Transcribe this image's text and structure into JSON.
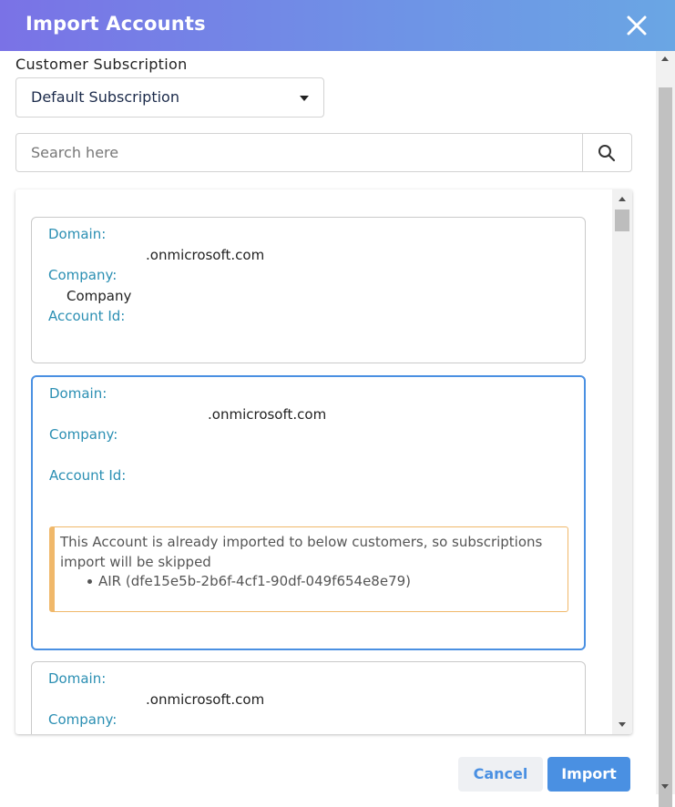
{
  "header": {
    "title": "Import Accounts"
  },
  "subscription": {
    "label": "Customer Subscription",
    "selected": "Default Subscription"
  },
  "search": {
    "placeholder": "Search here"
  },
  "accounts": [
    {
      "domain_label": "Domain:",
      "domain_value": ".onmicrosoft.com",
      "company_label": "Company:",
      "company_value": "Company",
      "account_label": "Account Id:",
      "account_value": ""
    },
    {
      "domain_label": "Domain:",
      "domain_value": ".onmicrosoft.com",
      "company_label": "Company:",
      "company_value": "",
      "account_label": "Account Id:",
      "account_value": "",
      "warning": {
        "message": "This Account is already imported to below customers, so subscriptions import will be skipped",
        "items": [
          "AIR (dfe15e5b-2b6f-4cf1-90df-049f654e8e79)"
        ]
      }
    },
    {
      "domain_label": "Domain:",
      "domain_value": ".onmicrosoft.com",
      "company_label": "Company:",
      "company_value": ""
    }
  ],
  "footer": {
    "cancel_label": "Cancel",
    "import_label": "Import"
  },
  "colors": {
    "accent": "#4a90e2",
    "field_label": "#2b8fb3",
    "warning": "#f0b86a"
  }
}
